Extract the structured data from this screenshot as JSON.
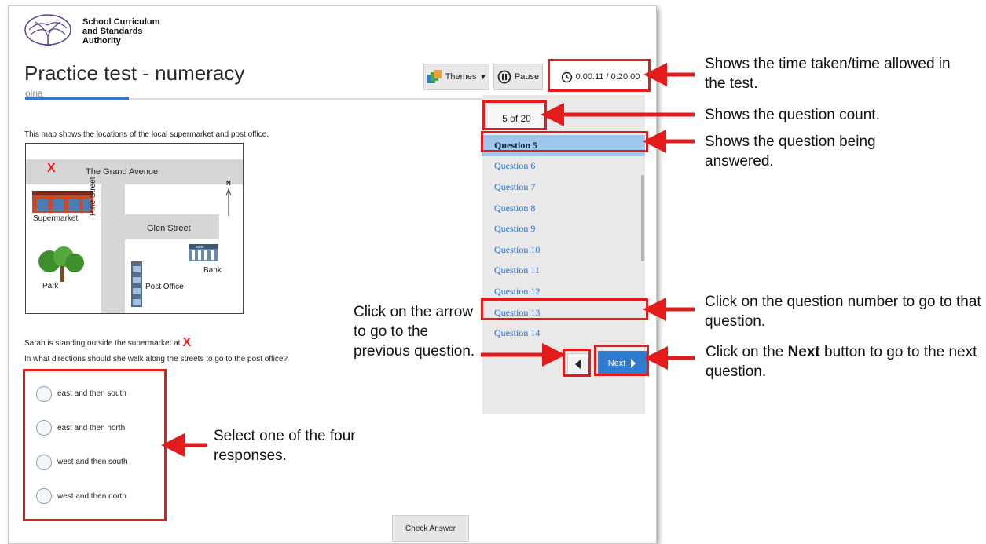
{
  "logo": {
    "line1": "School Curriculum",
    "line2": "and Standards",
    "line3": "Authority"
  },
  "header": {
    "title": "Practice test - numeracy",
    "subtitle": "olna"
  },
  "toolbar": {
    "themes_label": "Themes",
    "pause_label": "Pause",
    "timer": "0:00:11 / 0:20:00"
  },
  "nav": {
    "counter": "5 of 20",
    "questions": [
      "Question 5",
      "Question 6",
      "Question 7",
      "Question 8",
      "Question 9",
      "Question 10",
      "Question 11",
      "Question 12",
      "Question 13",
      "Question 14"
    ],
    "active_index": 0,
    "next_label": "Next"
  },
  "question": {
    "prompt": "This map shows the locations of the local supermarket and post office.",
    "map": {
      "street_top": "The Grand Avenue",
      "street_vertical": "Pine Street",
      "street_right": "Glen Street",
      "north": "N",
      "supermarket": "Supermarket",
      "bank": "Bank",
      "bank_sign": "BANK",
      "park": "Park",
      "post_office": "Post Office",
      "marker": "X"
    },
    "line1": "Sarah is standing outside the supermarket at",
    "marker": "X",
    "line2": "In what directions should she walk along the streets to go to the post office?",
    "options": [
      "east and then south",
      "east and then north",
      "west and then south",
      "west and then north"
    ],
    "check_label": "Check Answer"
  },
  "annotations": {
    "timer": "Shows the time taken/time allowed in the test.",
    "count": "Shows the question count.",
    "current": "Shows the question being answered.",
    "goto": "Click on the question number to go to that question.",
    "prev": "Click on the arrow to go to the previous question.",
    "next_pre": "Click on the",
    "next_bold": "Next",
    "next_post": "button to go to the next question.",
    "responses": "Select one of the four responses."
  },
  "colors": {
    "highlight": "#e31b1b",
    "accent": "#2f7ccf",
    "active_row": "#9fc6ec"
  }
}
